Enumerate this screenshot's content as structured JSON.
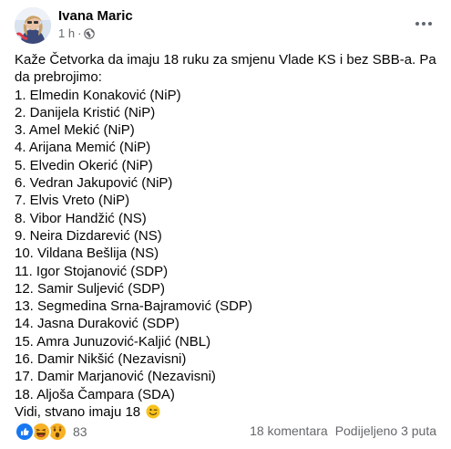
{
  "post": {
    "author": "Ivana Maric",
    "time": "1 h",
    "separator": "·",
    "audience_icon": "globe-icon",
    "more_icon": "more-options-icon",
    "lines": [
      "Kaže Četvorka da imaju 18 ruku za smjenu Vlade KS i bez SBB-a. Pa",
      "da prebrojimo:",
      "1. Elmedin Konaković (NiP)",
      "2. Danijela Kristić (NiP)",
      "3. Amel Mekić (NiP)",
      "4. Arijana Memić (NiP)",
      "5. Elvedin Okerić (NiP)",
      "6. Vedran Jakupović (NiP)",
      "7. Elvis Vreto (NiP)",
      "8. Vibor Handžić (NS)",
      "9. Neira Dizdarević (NS)",
      "10. Vildana Bešlija (NS)",
      "11. Igor Stojanović (SDP)",
      "12. Samir Suljević (SDP)",
      "13. Segmedina Srna-Bajramović (SDP)",
      "14. Jasna Duraković (SDP)",
      "15. Amra Junuzović-Kaljić (NBL)",
      "16. Damir Nikšić (Nezavisni)",
      "17. Damir Marjanović (Nezavisni)",
      "18. Aljoša Čampara (SDA)"
    ],
    "last_line": "Vidi, stvano imaju 18",
    "last_line_emoji": "wink-emoji"
  },
  "footer": {
    "reaction_icons": [
      "like-reaction-icon",
      "haha-reaction-icon",
      "wow-reaction-icon"
    ],
    "reaction_count": "83",
    "comments": "18 komentara",
    "shares": "Podijeljeno 3 puta"
  },
  "colors": {
    "text": "#050505",
    "secondary": "#65676b",
    "like_blue": "#1877f2",
    "reaction_yellow": "#f7b125"
  }
}
